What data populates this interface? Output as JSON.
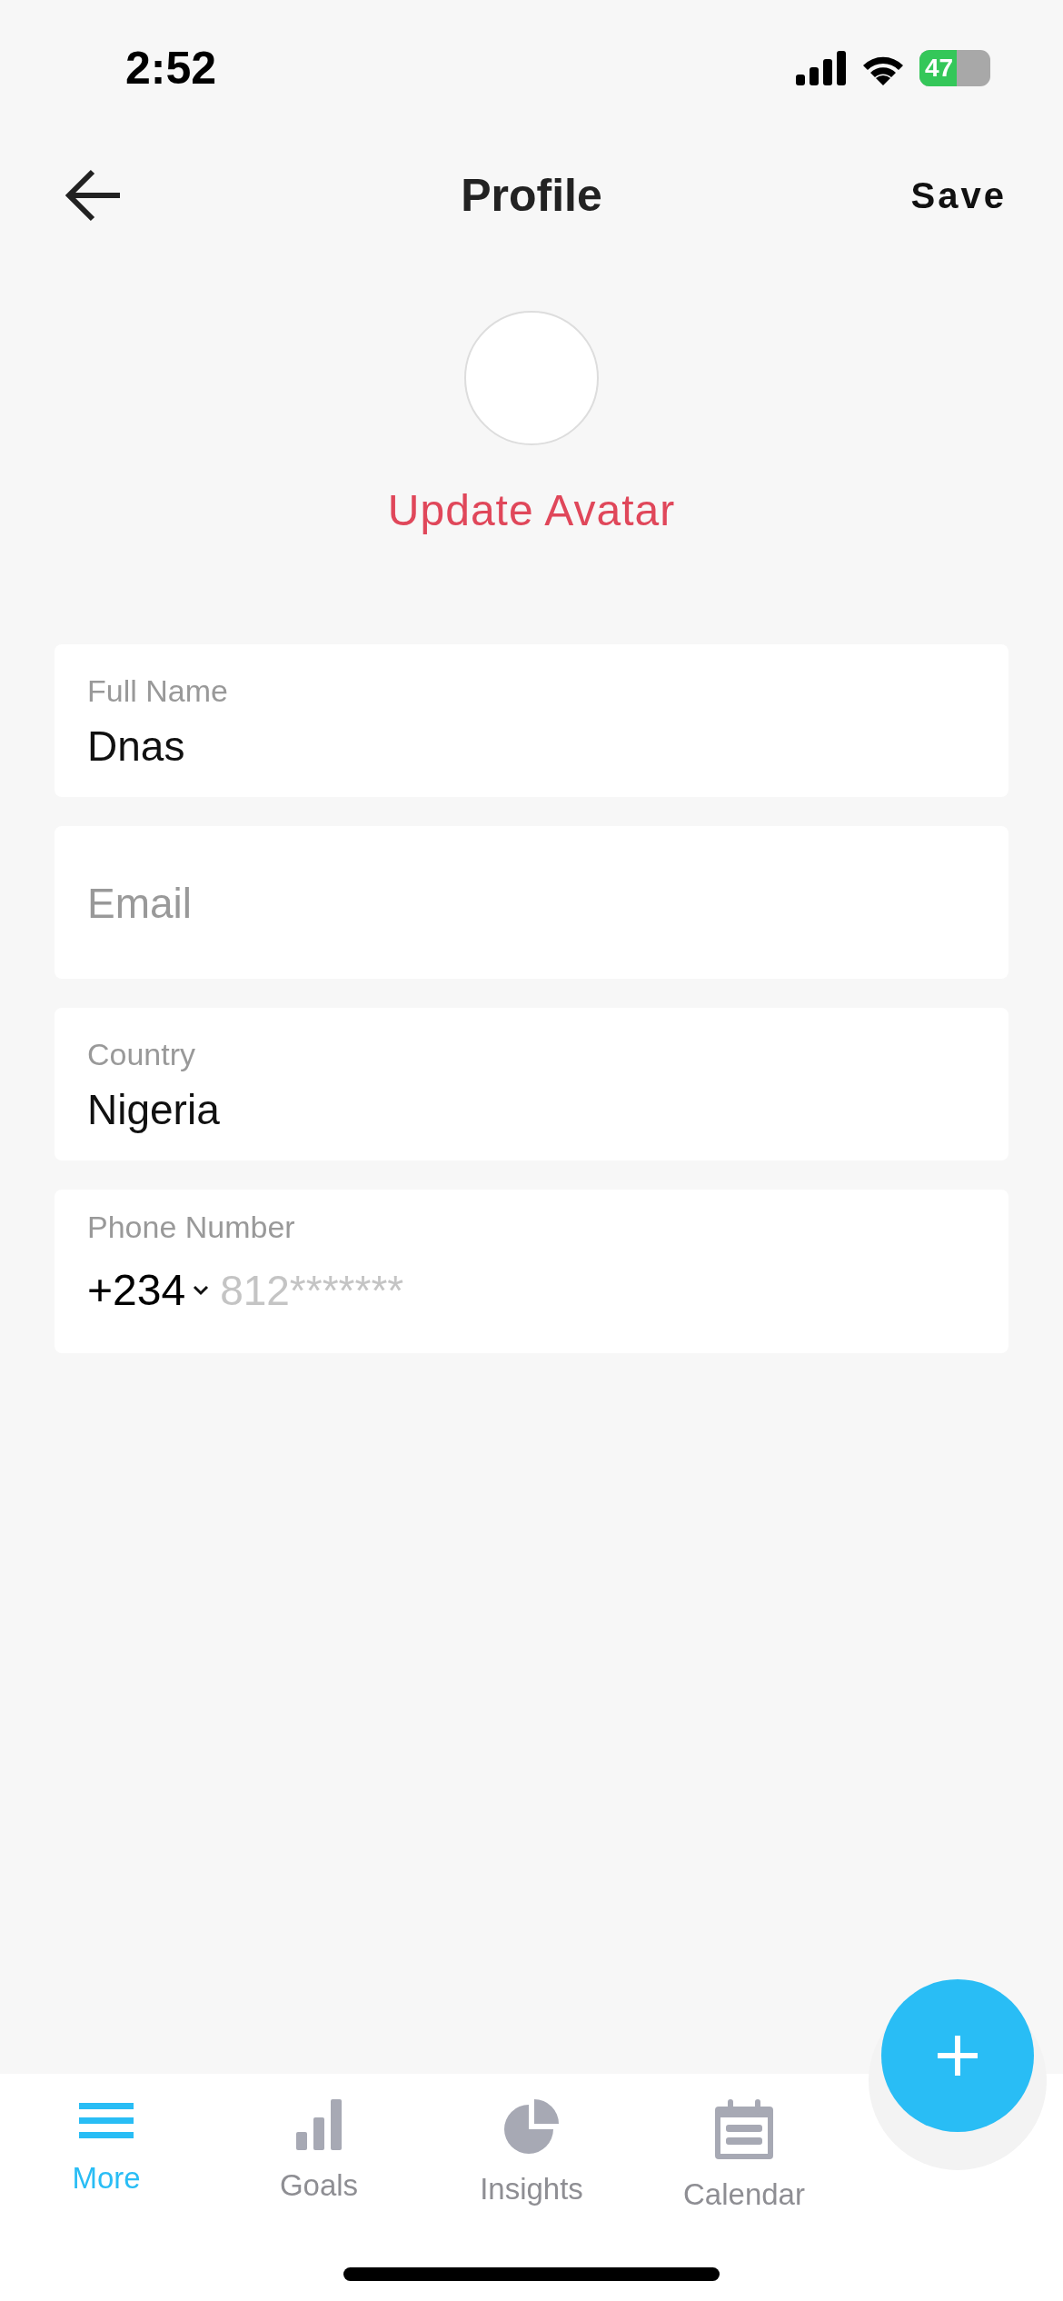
{
  "status_bar": {
    "time": "2:52",
    "battery": "47"
  },
  "header": {
    "title": "Profile",
    "action": "Save"
  },
  "avatar": {
    "action": "Update Avatar"
  },
  "fields": [
    {
      "kind": "text",
      "label": "Full Name",
      "value": "Dnas"
    },
    {
      "kind": "text",
      "placeholder": "Email"
    },
    {
      "kind": "text",
      "label": "Country",
      "value": "Nigeria"
    },
    {
      "kind": "phone",
      "label": "Phone Number",
      "code": "+234",
      "placeholder": "812*******"
    }
  ],
  "tabs": [
    {
      "label": "More",
      "kind": "menu",
      "selected": true
    },
    {
      "label": "Goals",
      "kind": "bars",
      "selected": false
    },
    {
      "label": "Insights",
      "kind": "pie",
      "selected": false
    },
    {
      "label": "Calendar",
      "kind": "calendar",
      "selected": false
    }
  ]
}
